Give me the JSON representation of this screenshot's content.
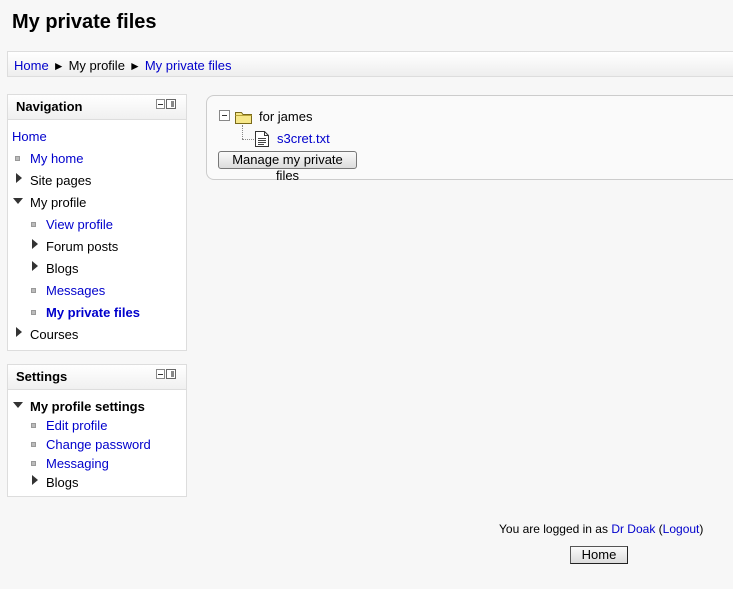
{
  "page": {
    "title": "My private files"
  },
  "breadcrumb": {
    "home": "Home",
    "sep": "►",
    "profile": "My profile",
    "current": "My private files"
  },
  "navigation": {
    "title": "Navigation",
    "home": "Home",
    "my_home": "My home",
    "site_pages": "Site pages",
    "my_profile": "My profile",
    "view_profile": "View profile",
    "forum_posts": "Forum posts",
    "blogs": "Blogs",
    "messages": "Messages",
    "my_private_files": "My private files",
    "courses": "Courses"
  },
  "settings": {
    "title": "Settings",
    "my_profile_settings": "My profile settings",
    "edit_profile": "Edit profile",
    "change_password": "Change password",
    "messaging": "Messaging",
    "blogs": "Blogs"
  },
  "files": {
    "folder_label": "for james",
    "file_name": "s3cret.txt",
    "manage_button": "Manage my private files"
  },
  "footer": {
    "logged_in_prefix": "You are logged in as ",
    "user": "Dr Doak",
    "open_paren": " (",
    "logout": "Logout",
    "close_paren": ")",
    "home_button": "Home"
  },
  "icons": [
    "folder-icon",
    "text-file-icon",
    "collapse-icon",
    "block-hide-icon",
    "block-dock-icon"
  ]
}
